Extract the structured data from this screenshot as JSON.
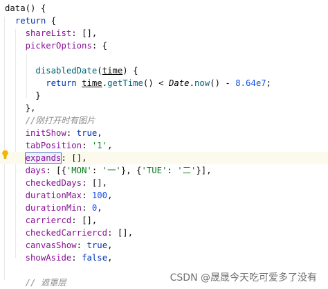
{
  "code_lines": [
    [
      {
        "t": "data() {",
        "c": "plain"
      }
    ],
    [
      {
        "t": "  ",
        "c": "plain"
      },
      {
        "t": "return",
        "c": "kw"
      },
      {
        "t": " {",
        "c": "plain"
      }
    ],
    [
      {
        "t": "    ",
        "c": "plain"
      },
      {
        "t": "shareList",
        "c": "prop"
      },
      {
        "t": ": [],",
        "c": "plain"
      }
    ],
    [
      {
        "t": "    ",
        "c": "plain"
      },
      {
        "t": "pickerOptions",
        "c": "prop"
      },
      {
        "t": ": {",
        "c": "plain"
      }
    ],
    [
      {
        "t": "",
        "c": "plain"
      }
    ],
    [
      {
        "t": "      ",
        "c": "plain"
      },
      {
        "t": "disabledDate",
        "c": "fn"
      },
      {
        "t": "(",
        "c": "plain"
      },
      {
        "t": "time",
        "c": "param"
      },
      {
        "t": ") {",
        "c": "plain"
      }
    ],
    [
      {
        "t": "        ",
        "c": "plain"
      },
      {
        "t": "return",
        "c": "kw"
      },
      {
        "t": " ",
        "c": "plain"
      },
      {
        "t": "time",
        "c": "param"
      },
      {
        "t": ".",
        "c": "plain"
      },
      {
        "t": "getTime",
        "c": "fn"
      },
      {
        "t": "() < ",
        "c": "plain"
      },
      {
        "t": "Date",
        "c": "cls"
      },
      {
        "t": ".",
        "c": "plain"
      },
      {
        "t": "now",
        "c": "fn"
      },
      {
        "t": "() - ",
        "c": "plain"
      },
      {
        "t": "8.64e7",
        "c": "num"
      },
      {
        "t": ";",
        "c": "plain"
      }
    ],
    [
      {
        "t": "      }",
        "c": "plain"
      }
    ],
    [
      {
        "t": "    },",
        "c": "plain"
      }
    ],
    [
      {
        "t": "    ",
        "c": "plain"
      },
      {
        "t": "//刚打开时有图片",
        "c": "cmt"
      }
    ],
    [
      {
        "t": "    ",
        "c": "plain"
      },
      {
        "t": "initShow",
        "c": "prop"
      },
      {
        "t": ": ",
        "c": "plain"
      },
      {
        "t": "true",
        "c": "kw"
      },
      {
        "t": ",",
        "c": "plain"
      }
    ],
    [
      {
        "t": "    ",
        "c": "plain"
      },
      {
        "t": "tabPosition",
        "c": "prop"
      },
      {
        "t": ": ",
        "c": "plain"
      },
      {
        "t": "'1'",
        "c": "str"
      },
      {
        "t": ",",
        "c": "plain"
      }
    ],
    [
      {
        "t": "    ",
        "c": "plain"
      },
      {
        "t": "expands",
        "c": "prop sel"
      },
      {
        "t": ": [],",
        "c": "plain"
      }
    ],
    [
      {
        "t": "    ",
        "c": "plain"
      },
      {
        "t": "days",
        "c": "prop"
      },
      {
        "t": ": [{",
        "c": "plain"
      },
      {
        "t": "'MON'",
        "c": "str"
      },
      {
        "t": ": ",
        "c": "plain"
      },
      {
        "t": "'一'",
        "c": "str"
      },
      {
        "t": "}, {",
        "c": "plain"
      },
      {
        "t": "'TUE'",
        "c": "str"
      },
      {
        "t": ": ",
        "c": "plain"
      },
      {
        "t": "'二'",
        "c": "str"
      },
      {
        "t": "}],",
        "c": "plain"
      }
    ],
    [
      {
        "t": "    ",
        "c": "plain"
      },
      {
        "t": "checkedDays",
        "c": "prop"
      },
      {
        "t": ": [],",
        "c": "plain"
      }
    ],
    [
      {
        "t": "    ",
        "c": "plain"
      },
      {
        "t": "durationMax",
        "c": "prop"
      },
      {
        "t": ": ",
        "c": "plain"
      },
      {
        "t": "100",
        "c": "num"
      },
      {
        "t": ",",
        "c": "plain"
      }
    ],
    [
      {
        "t": "    ",
        "c": "plain"
      },
      {
        "t": "durationMin",
        "c": "prop"
      },
      {
        "t": ": ",
        "c": "plain"
      },
      {
        "t": "0",
        "c": "num"
      },
      {
        "t": ",",
        "c": "plain"
      }
    ],
    [
      {
        "t": "    ",
        "c": "plain"
      },
      {
        "t": "carriercd",
        "c": "prop"
      },
      {
        "t": ": [],",
        "c": "plain"
      }
    ],
    [
      {
        "t": "    ",
        "c": "plain"
      },
      {
        "t": "checkedCarriercd",
        "c": "prop"
      },
      {
        "t": ": [],",
        "c": "plain"
      }
    ],
    [
      {
        "t": "    ",
        "c": "plain"
      },
      {
        "t": "canvasShow",
        "c": "prop"
      },
      {
        "t": ": ",
        "c": "plain"
      },
      {
        "t": "true",
        "c": "kw"
      },
      {
        "t": ",",
        "c": "plain"
      }
    ],
    [
      {
        "t": "    ",
        "c": "plain"
      },
      {
        "t": "showAside",
        "c": "prop"
      },
      {
        "t": ": ",
        "c": "plain"
      },
      {
        "t": "false",
        "c": "kw"
      },
      {
        "t": ",",
        "c": "plain"
      }
    ],
    [
      {
        "t": "",
        "c": "plain"
      }
    ],
    [
      {
        "t": "    ",
        "c": "plain"
      },
      {
        "t": "// 遮罩层",
        "c": "cmt"
      }
    ]
  ],
  "caret_line_index": 12,
  "gutter_icon": "lightbulb-icon",
  "watermark": "CSDN @晟晟今天吃可爱多了没有",
  "colors": {
    "keyword": "#0033b3",
    "property": "#871094",
    "string": "#067d17",
    "number": "#1750eb",
    "function": "#00627a",
    "comment": "#8c8c8c",
    "caret_line_bg": "#fcfaed",
    "selection_outline": "#4a6bd6"
  }
}
